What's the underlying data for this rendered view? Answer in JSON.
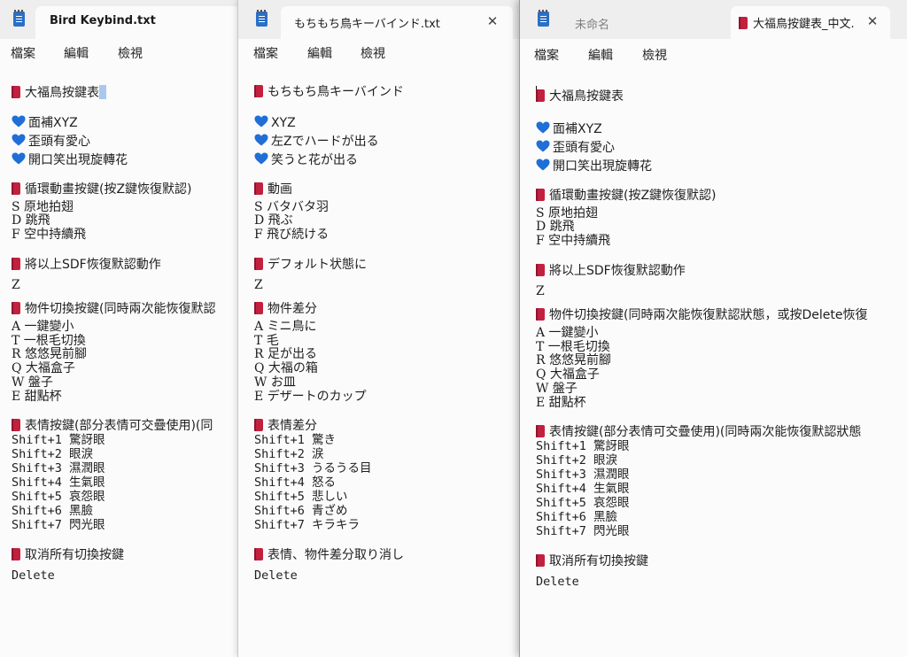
{
  "colors": {
    "book": "#c2203f",
    "heart": "#1f6fd6",
    "selection": "#aac8ee"
  },
  "menu": {
    "file": "檔案",
    "edit": "編輯",
    "view": "檢視"
  },
  "window1": {
    "tab_title": "Bird Keybind.txt",
    "lines": [
      {
        "type": "book",
        "text": "大福鳥按鍵表"
      },
      {
        "type": "heart",
        "text": "面補XYZ"
      },
      {
        "type": "heart",
        "text": "歪頭有愛心"
      },
      {
        "type": "heart",
        "text": "開口笑出現旋轉花"
      },
      {
        "type": "book",
        "text": "循環動畫按鍵(按Z鍵恢復默認)"
      },
      {
        "type": "text",
        "text": "S 原地拍翅"
      },
      {
        "type": "text",
        "text": "D 跳飛"
      },
      {
        "type": "text",
        "text": "F 空中持續飛"
      },
      {
        "type": "book",
        "text": "將以上SDF恢復默認動作"
      },
      {
        "type": "text",
        "text": "Z"
      },
      {
        "type": "book",
        "text": "物件切換按鍵(同時兩次能恢復默認"
      },
      {
        "type": "text",
        "text": "A 一鍵變小"
      },
      {
        "type": "text",
        "text": "T 一根毛切換"
      },
      {
        "type": "text",
        "text": "R 悠悠晃前腳"
      },
      {
        "type": "text",
        "text": "Q 大福盒子"
      },
      {
        "type": "text",
        "text": "W 盤子"
      },
      {
        "type": "text",
        "text": "E 甜點杯"
      },
      {
        "type": "book",
        "text": "表情按鍵(部分表情可交疊使用)(同"
      },
      {
        "type": "mono",
        "text": "Shift+1 驚訝眼"
      },
      {
        "type": "mono",
        "text": "Shift+2 眼淚"
      },
      {
        "type": "mono",
        "text": "Shift+3 濕潤眼"
      },
      {
        "type": "mono",
        "text": "Shift+4 生氣眼"
      },
      {
        "type": "mono",
        "text": "Shift+5 哀怨眼"
      },
      {
        "type": "mono",
        "text": "Shift+6 黑臉"
      },
      {
        "type": "mono",
        "text": "Shift+7 閃光眼"
      },
      {
        "type": "book",
        "text": "取消所有切換按鍵"
      },
      {
        "type": "mono",
        "text": "Delete"
      }
    ]
  },
  "window2": {
    "tab_title": "もちもち鳥キーバインド.txt",
    "lines": [
      {
        "type": "book",
        "text": "もちもち鳥キーバインド"
      },
      {
        "type": "heart",
        "text": "XYZ"
      },
      {
        "type": "heart",
        "text": "左Zでハードが出る"
      },
      {
        "type": "heart",
        "text": "笑うと花が出る"
      },
      {
        "type": "book",
        "text": "動画"
      },
      {
        "type": "text",
        "text": "S バタバタ羽"
      },
      {
        "type": "text",
        "text": "D 飛ぶ"
      },
      {
        "type": "text",
        "text": "F 飛び続ける"
      },
      {
        "type": "book",
        "text": "デフォルト状態に"
      },
      {
        "type": "text",
        "text": "Z"
      },
      {
        "type": "book",
        "text": "物件差分"
      },
      {
        "type": "text",
        "text": "A ミニ鳥に"
      },
      {
        "type": "text",
        "text": "T 毛"
      },
      {
        "type": "text",
        "text": "R 足が出る"
      },
      {
        "type": "text",
        "text": "Q 大福の箱"
      },
      {
        "type": "text",
        "text": "W お皿"
      },
      {
        "type": "text",
        "text": "E デザートのカップ"
      },
      {
        "type": "book",
        "text": "表情差分"
      },
      {
        "type": "mono",
        "text": "Shift+1 驚き"
      },
      {
        "type": "mono",
        "text": "Shift+2 涙"
      },
      {
        "type": "mono",
        "text": "Shift+3 うるうる目"
      },
      {
        "type": "mono",
        "text": "Shift+4 怒る"
      },
      {
        "type": "mono",
        "text": "Shift+5 悲しい"
      },
      {
        "type": "mono",
        "text": "Shift+6 青ざめ"
      },
      {
        "type": "mono",
        "text": "Shift+7 キラキラ"
      },
      {
        "type": "book",
        "text": "表情、物件差分取り消し"
      },
      {
        "type": "mono",
        "text": "Delete"
      }
    ]
  },
  "window3": {
    "inactive_tab_title": "未命名",
    "tab_title": "大福鳥按鍵表_中文.",
    "lines": [
      {
        "type": "book",
        "text": "大福鳥按鍵表"
      },
      {
        "type": "heart",
        "text": "面補XYZ"
      },
      {
        "type": "heart",
        "text": "歪頭有愛心"
      },
      {
        "type": "heart",
        "text": "開口笑出現旋轉花"
      },
      {
        "type": "book",
        "text": "循環動畫按鍵(按Z鍵恢復默認)"
      },
      {
        "type": "text",
        "text": "S 原地拍翅"
      },
      {
        "type": "text",
        "text": "D 跳飛"
      },
      {
        "type": "text",
        "text": "F 空中持續飛"
      },
      {
        "type": "book",
        "text": "將以上SDF恢復默認動作"
      },
      {
        "type": "text",
        "text": "Z"
      },
      {
        "type": "book",
        "text": "物件切換按鍵(同時兩次能恢復默認狀態，或按Delete恢復"
      },
      {
        "type": "text",
        "text": "A 一鍵變小"
      },
      {
        "type": "text",
        "text": "T 一根毛切換"
      },
      {
        "type": "text",
        "text": "R 悠悠晃前腳"
      },
      {
        "type": "text",
        "text": "Q 大福盒子"
      },
      {
        "type": "text",
        "text": "W 盤子"
      },
      {
        "type": "text",
        "text": "E 甜點杯"
      },
      {
        "type": "book",
        "text": "表情按鍵(部分表情可交疊使用)(同時兩次能恢復默認狀態"
      },
      {
        "type": "mono",
        "text": "Shift+1 驚訝眼"
      },
      {
        "type": "mono",
        "text": "Shift+2 眼淚"
      },
      {
        "type": "mono",
        "text": "Shift+3 濕潤眼"
      },
      {
        "type": "mono",
        "text": "Shift+4 生氣眼"
      },
      {
        "type": "mono",
        "text": "Shift+5 哀怨眼"
      },
      {
        "type": "mono",
        "text": "Shift+6 黑臉"
      },
      {
        "type": "mono",
        "text": "Shift+7 閃光眼"
      },
      {
        "type": "book",
        "text": "取消所有切換按鍵"
      },
      {
        "type": "mono",
        "text": "Delete"
      }
    ]
  }
}
